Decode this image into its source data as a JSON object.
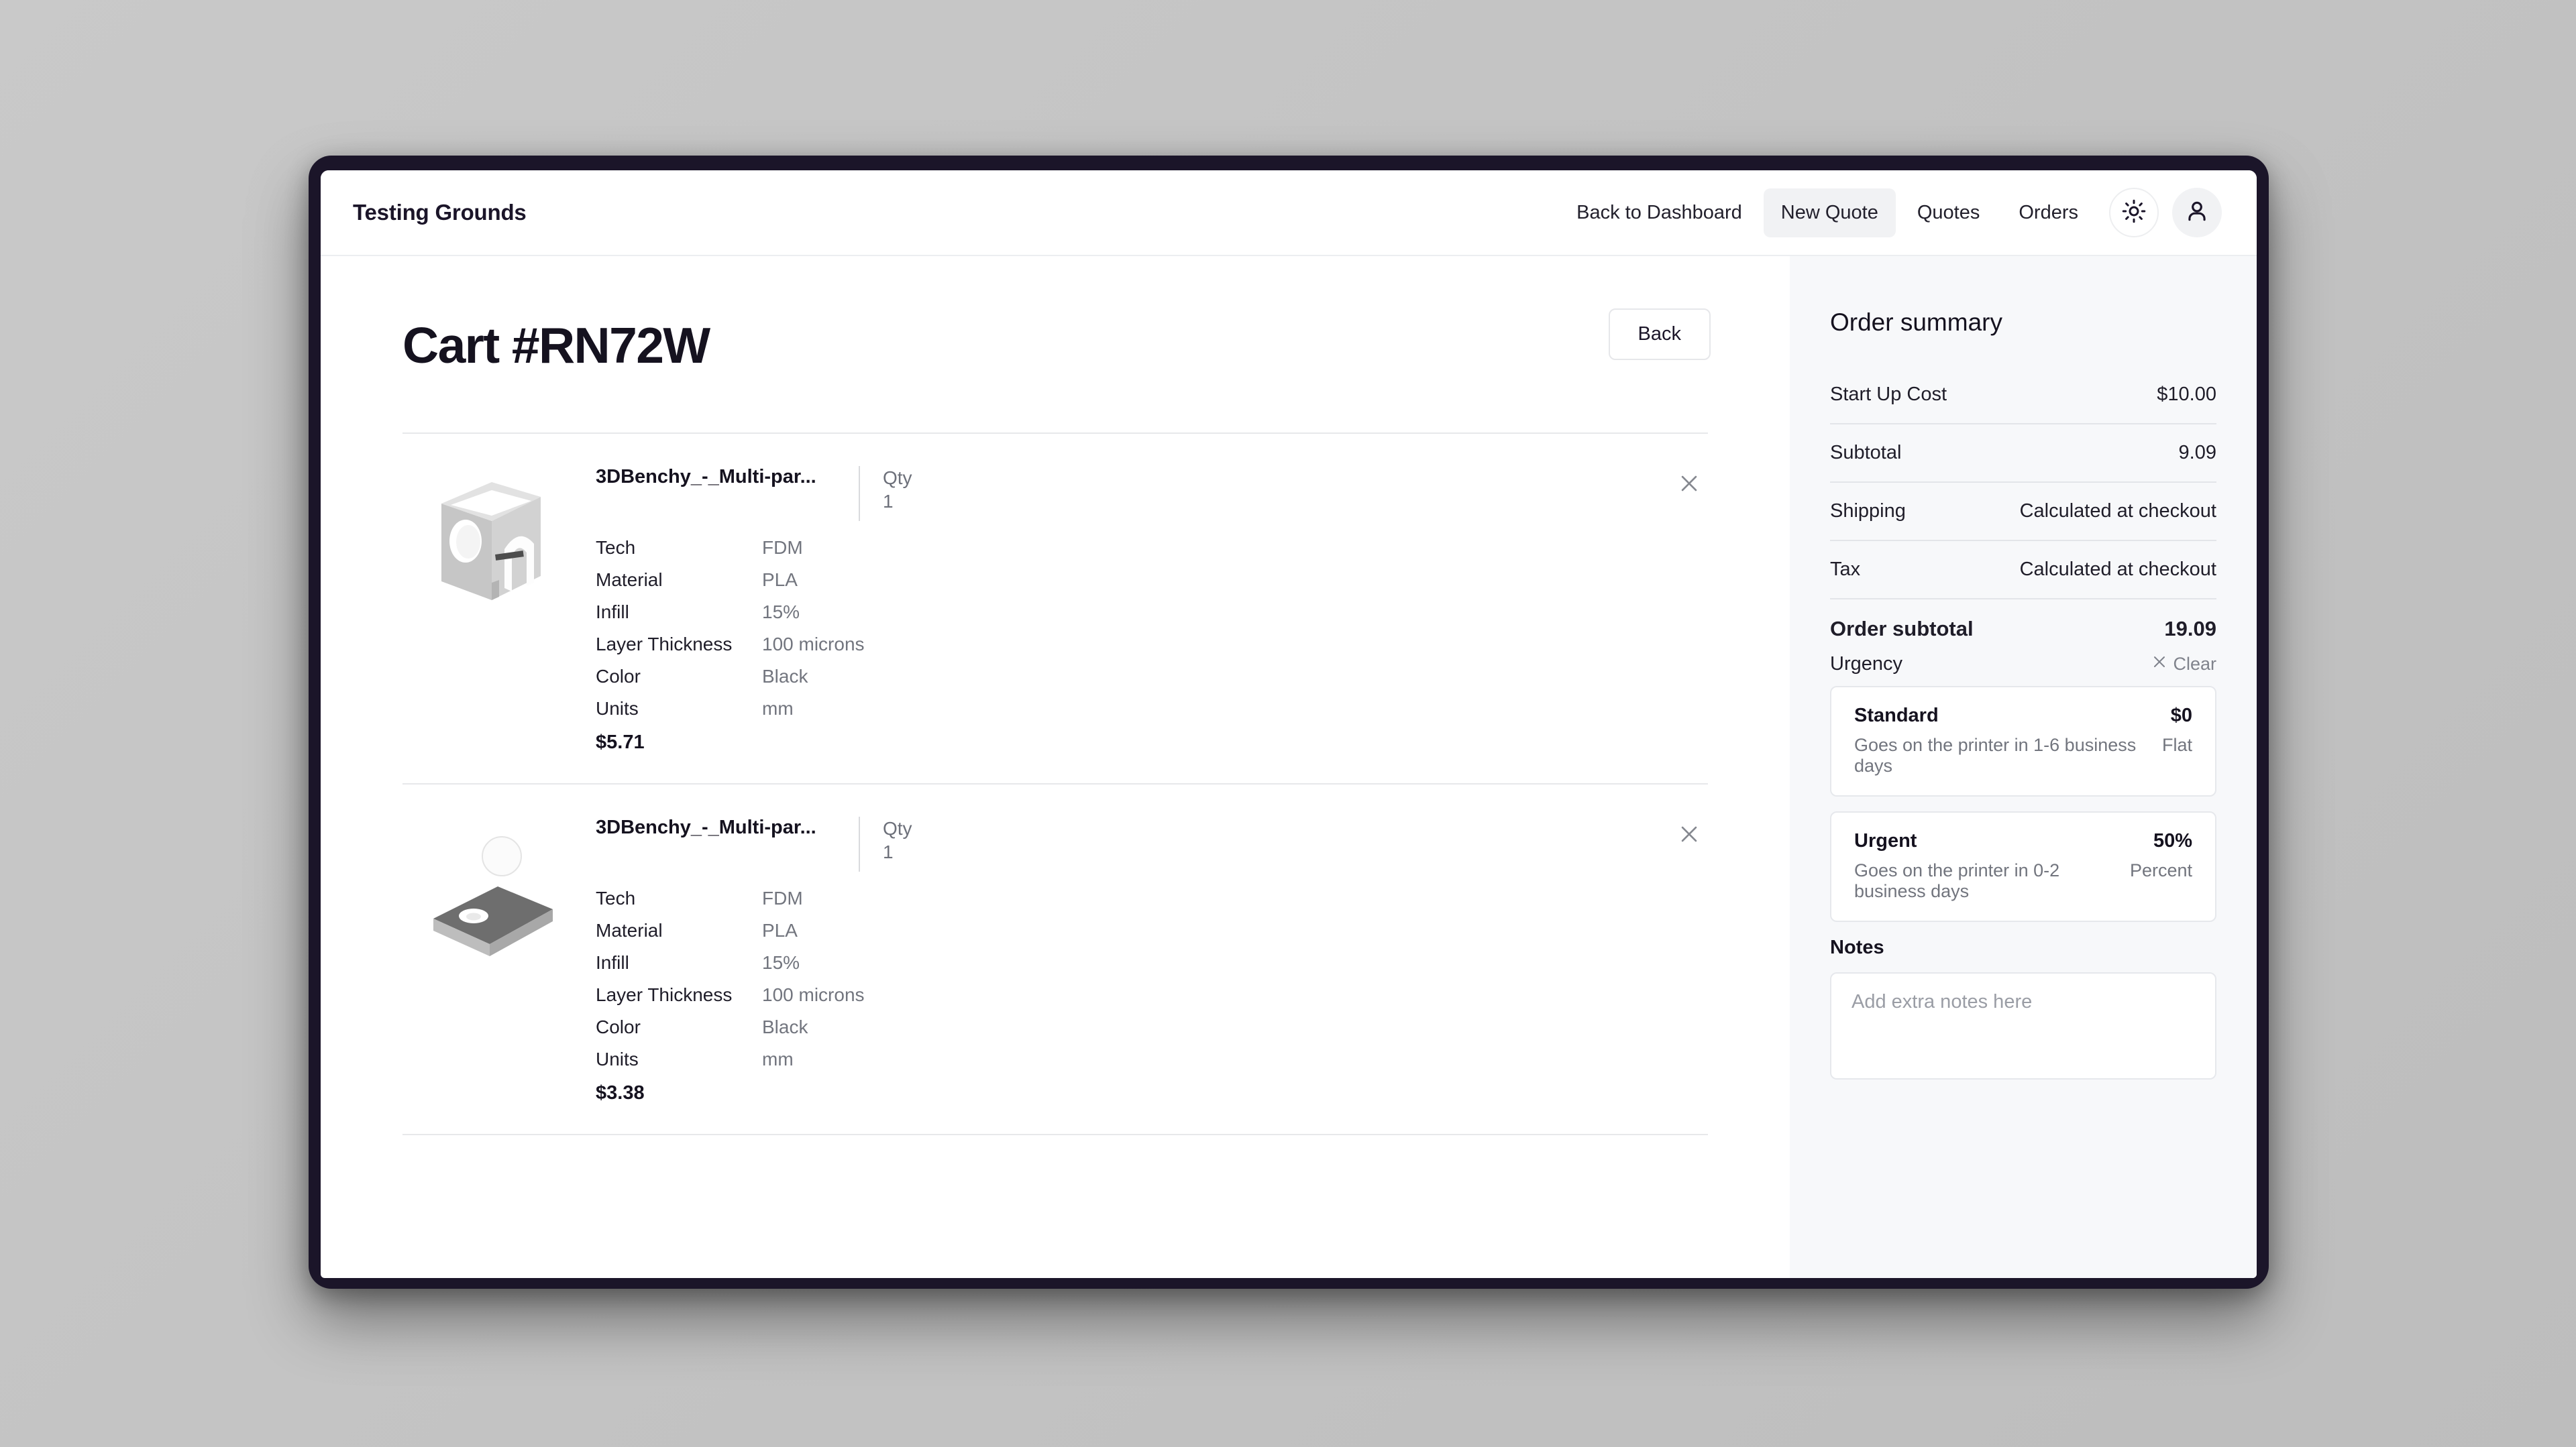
{
  "nav": {
    "brand": "Testing Grounds",
    "links": [
      {
        "label": "Back to Dashboard",
        "active": false
      },
      {
        "label": "New Quote",
        "active": true
      },
      {
        "label": "Quotes",
        "active": false
      },
      {
        "label": "Orders",
        "active": false
      }
    ],
    "theme_icon": "sun-icon",
    "avatar_icon": "user-icon"
  },
  "page": {
    "title": "Cart #RN72W",
    "back_label": "Back"
  },
  "cart": {
    "items": [
      {
        "name": "3DBenchy_-_Multi-par...",
        "qty_label": "Qty",
        "qty_value": "1",
        "remove_icon": "close-icon",
        "specs": [
          {
            "key": "Tech",
            "value": "FDM"
          },
          {
            "key": "Material",
            "value": "PLA"
          },
          {
            "key": "Infill",
            "value": "15%"
          },
          {
            "key": "Layer Thickness",
            "value": "100 microns"
          },
          {
            "key": "Color",
            "value": "Black"
          },
          {
            "key": "Units",
            "value": "mm"
          }
        ],
        "price": "$5.71"
      },
      {
        "name": "3DBenchy_-_Multi-par...",
        "qty_label": "Qty",
        "qty_value": "1",
        "remove_icon": "close-icon",
        "specs": [
          {
            "key": "Tech",
            "value": "FDM"
          },
          {
            "key": "Material",
            "value": "PLA"
          },
          {
            "key": "Infill",
            "value": "15%"
          },
          {
            "key": "Layer Thickness",
            "value": "100 microns"
          },
          {
            "key": "Color",
            "value": "Black"
          },
          {
            "key": "Units",
            "value": "mm"
          }
        ],
        "price": "$3.38"
      }
    ]
  },
  "summary": {
    "title": "Order summary",
    "rows": [
      {
        "key": "Start Up Cost",
        "value": "$10.00"
      },
      {
        "key": "Subtotal",
        "value": "9.09"
      },
      {
        "key": "Shipping",
        "value": "Calculated at checkout"
      },
      {
        "key": "Tax",
        "value": "Calculated at checkout"
      }
    ],
    "total": {
      "key": "Order subtotal",
      "value": "19.09"
    },
    "urgency": {
      "label": "Urgency",
      "clear_label": "Clear",
      "options": [
        {
          "name": "Standard",
          "description": "Goes on the printer in 1-6 business days",
          "price": "$0",
          "mode": "Flat"
        },
        {
          "name": "Urgent",
          "description": "Goes on the printer in 0-2 business days",
          "price": "50%",
          "mode": "Percent"
        }
      ]
    },
    "notes": {
      "label": "Notes",
      "placeholder": "Add extra notes here",
      "value": ""
    }
  },
  "colors": {
    "frame": "#1b1529",
    "panel_bg": "#f7f8fa",
    "text": "#15121f",
    "muted": "#72757e",
    "border": "#e6e8ec"
  }
}
